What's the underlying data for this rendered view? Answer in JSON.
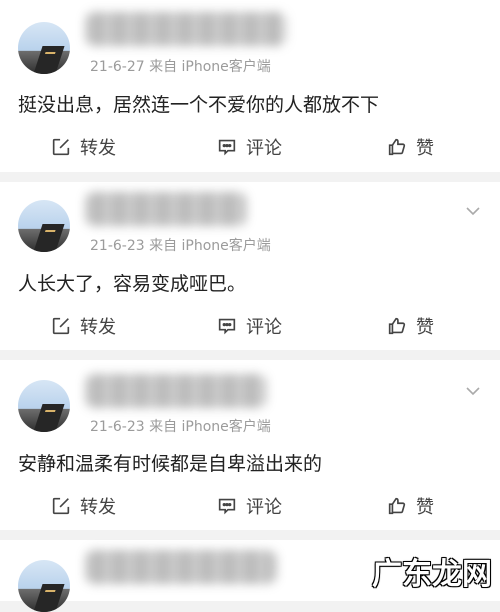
{
  "posts": [
    {
      "meta": "21-6-27  来自 iPhone客户端",
      "text": "挺没出息，居然连一个不爱你的人都放不下",
      "actions": {
        "repost": "转发",
        "comment": "评论",
        "like": "赞"
      }
    },
    {
      "meta": "21-6-23  来自 iPhone客户端",
      "text": "人长大了，容易变成哑巴。",
      "actions": {
        "repost": "转发",
        "comment": "评论",
        "like": "赞"
      }
    },
    {
      "meta": "21-6-23  来自 iPhone客户端",
      "text": "安静和温柔有时候都是自卑溢出来的",
      "actions": {
        "repost": "转发",
        "comment": "评论",
        "like": "赞"
      }
    },
    {
      "meta": "",
      "text": "",
      "actions": {}
    }
  ],
  "watermark": "广东龙网",
  "icons": {
    "repost": "share-square-icon",
    "comment": "comment-bubble-icon",
    "like": "thumbs-up-icon",
    "more": "chevron-down-icon"
  }
}
